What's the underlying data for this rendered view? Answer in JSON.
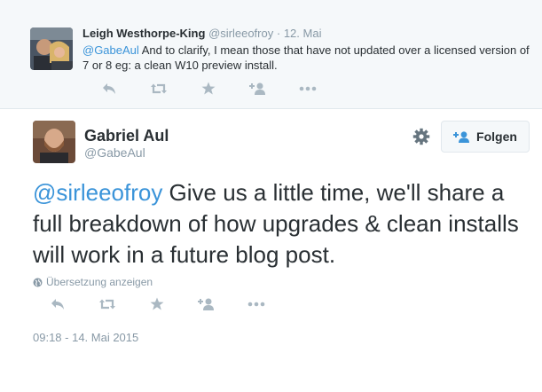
{
  "reply_tweet": {
    "name": "Leigh Westhorpe-King",
    "handle": "@sirleeofroy",
    "separator": "·",
    "date": "12. Mai",
    "mention": "@GabeAul",
    "text": " And to clarify, I mean those that have not updated over a licensed version of 7 or 8 eg: a clean W10 preview install."
  },
  "main_tweet": {
    "name": "Gabriel Aul",
    "handle": "@GabeAul",
    "follow_label": "Folgen",
    "mention": "@sirleeofroy",
    "text": " Give us a little time, we'll share a full breakdown of how upgrades & clean installs will work in a future blog post.",
    "translate_label": "Übersetzung anzeigen",
    "timestamp": "09:18 - 14. Mai 2015"
  },
  "colors": {
    "link": "#3b94d9",
    "muted": "#8899a6",
    "icon": "#aab8c2",
    "text": "#292f33",
    "panel": "#f5f8fa"
  },
  "icons": [
    "reply-icon",
    "retweet-icon",
    "favorite-icon",
    "follow-icon",
    "more-icon",
    "gear-icon",
    "globe-icon",
    "follow-person-icon"
  ]
}
